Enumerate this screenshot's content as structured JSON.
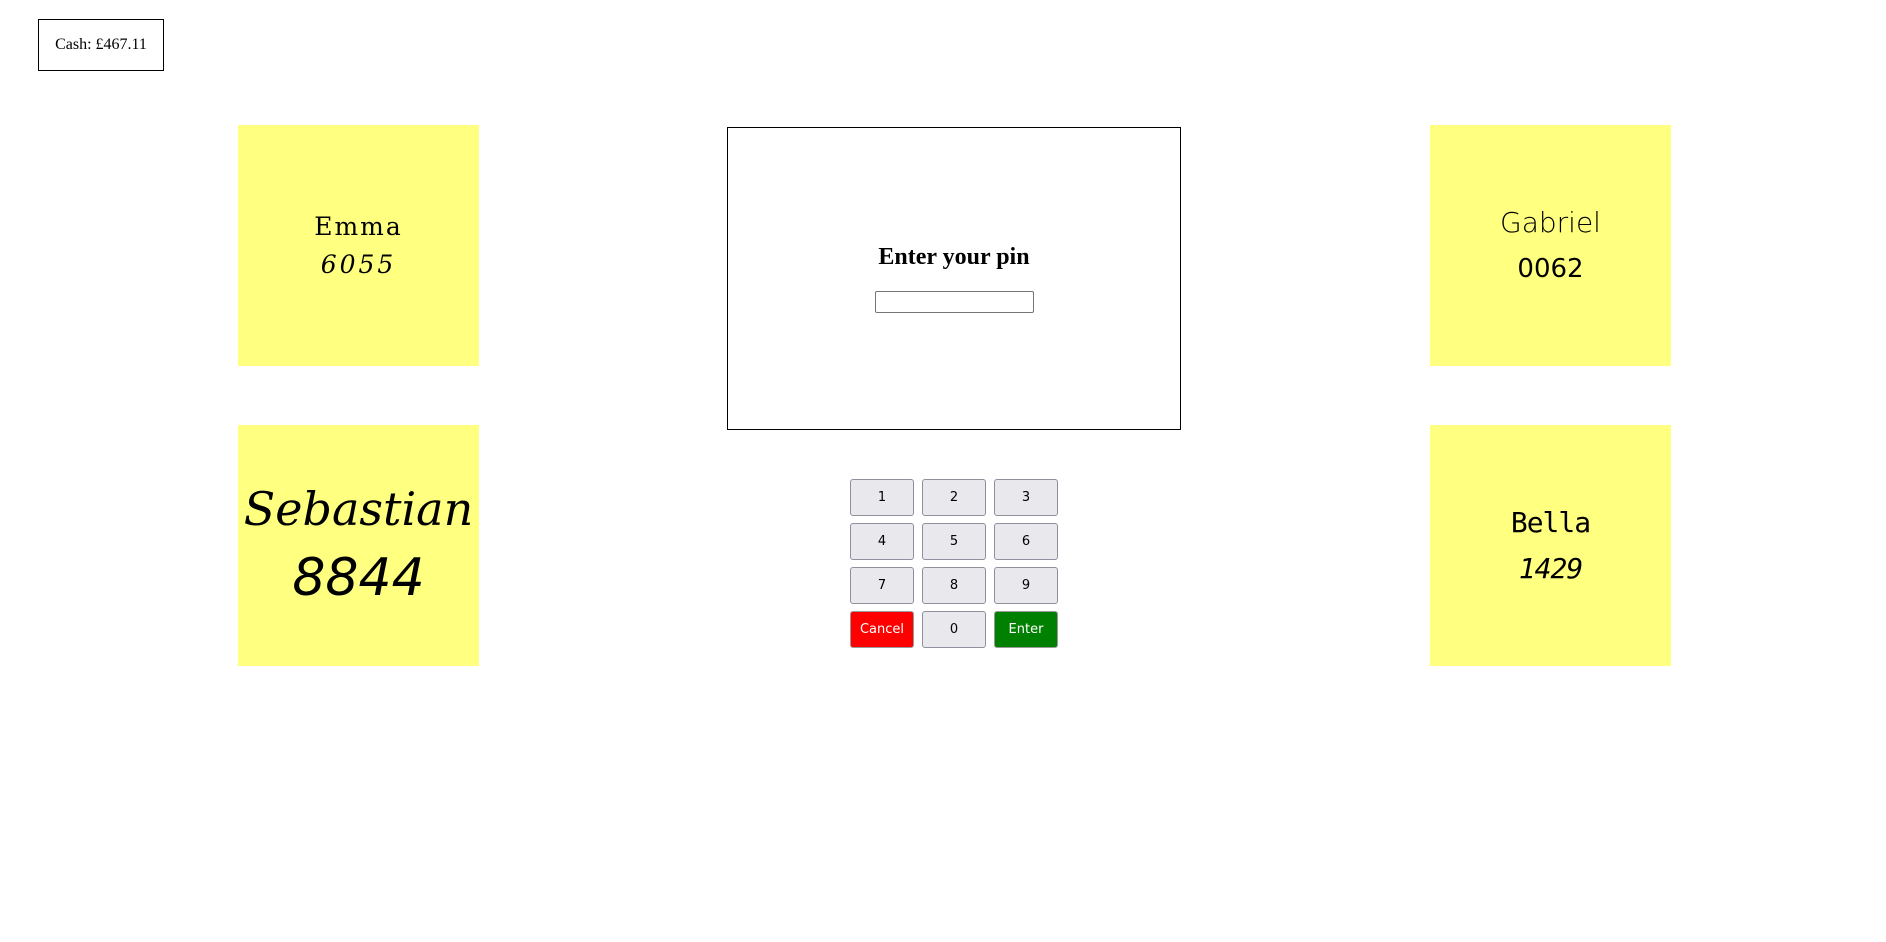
{
  "cash": {
    "label": "Cash: £467.11"
  },
  "notes": [
    {
      "name": "Emma",
      "pin": "6055"
    },
    {
      "name": "Gabriel",
      "pin": "0062"
    },
    {
      "name": "Sebastian",
      "pin": "8844"
    },
    {
      "name": "Bella",
      "pin": "1429"
    }
  ],
  "screen": {
    "prompt": "Enter your pin",
    "pin_value": ""
  },
  "keypad": {
    "keys": [
      "1",
      "2",
      "3",
      "4",
      "5",
      "6",
      "7",
      "8",
      "9"
    ],
    "cancel_label": "Cancel",
    "zero_label": "0",
    "enter_label": "Enter",
    "cancel_color": "#ff0000",
    "enter_color": "#008000"
  },
  "colors": {
    "note_background": "#ffff80"
  }
}
